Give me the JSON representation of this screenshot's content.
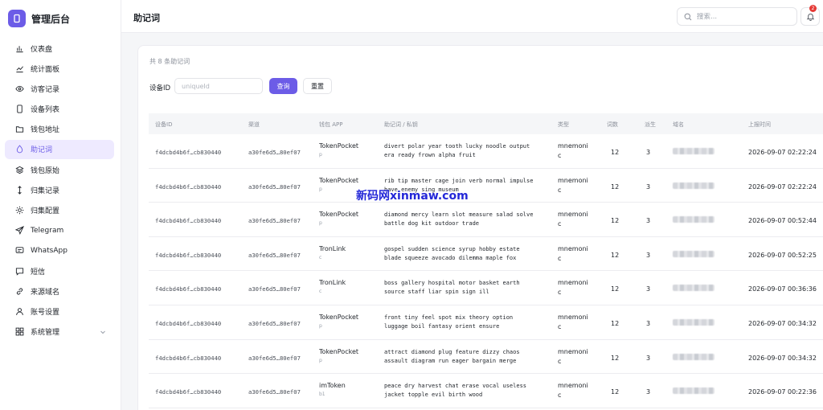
{
  "brand": {
    "title": "管理后台"
  },
  "sidebar": {
    "items": [
      {
        "label": "仪表盘",
        "icon": "bar-chart-icon"
      },
      {
        "label": "统计面板",
        "icon": "line-chart-icon"
      },
      {
        "label": "访客记录",
        "icon": "eye-icon"
      },
      {
        "label": "设备列表",
        "icon": "phone-icon"
      },
      {
        "label": "钱包地址",
        "icon": "folder-icon"
      },
      {
        "label": "助记词",
        "icon": "droplet-icon",
        "active": true
      },
      {
        "label": "钱包原始",
        "icon": "layers-icon"
      },
      {
        "label": "归集记录",
        "icon": "arrows-vertical-icon"
      },
      {
        "label": "归集配置",
        "icon": "sun-icon"
      },
      {
        "label": "Telegram",
        "icon": "send-icon"
      },
      {
        "label": "WhatsApp",
        "icon": "message-icon"
      },
      {
        "label": "短信",
        "icon": "chat-icon"
      },
      {
        "label": "来源域名",
        "icon": "link-icon"
      },
      {
        "label": "账号设置",
        "icon": "user-icon"
      },
      {
        "label": "系统管理",
        "icon": "grid-icon",
        "has_chevron": true
      }
    ]
  },
  "header": {
    "title": "助记词",
    "search_placeholder": "搜索...",
    "notification_count": "2"
  },
  "main": {
    "count_text": "共 8 条助记词",
    "filter": {
      "label": "设备ID",
      "placeholder": "uniqueId",
      "query_label": "查询",
      "reset_label": "重置"
    },
    "columns": [
      "设备ID",
      "渠道",
      "钱包 APP",
      "助记词 / 私钥",
      "类型",
      "词数",
      "派生",
      "域名",
      "上报时间"
    ],
    "rows": [
      {
        "device": "f4dcbd4b6f…cb830440",
        "channel": "a30fe6d5…80ef07",
        "app": "TokenPocket",
        "app_sub": "p",
        "mnemonic_1": "divert polar year tooth lucky noodle output",
        "mnemonic_2": "era ready frown alpha fruit",
        "type": "mnemonic",
        "words": "12",
        "derive": "3",
        "time": "2026-09-07 02:22:24"
      },
      {
        "device": "f4dcbd4b6f…cb830440",
        "channel": "a30fe6d5…80ef07",
        "app": "TokenPocket",
        "app_sub": "p",
        "mnemonic_1": "rib tip master cage join verb normal impulse",
        "mnemonic_2": "have enemy sing museum",
        "type": "mnemonic",
        "words": "12",
        "derive": "3",
        "time": "2026-09-07 02:22:24"
      },
      {
        "device": "f4dcbd4b6f…cb830440",
        "channel": "a30fe6d5…80ef07",
        "app": "TokenPocket",
        "app_sub": "p",
        "mnemonic_1": "diamond mercy learn slot measure salad solve",
        "mnemonic_2": "battle dog kit outdoor trade",
        "type": "mnemonic",
        "words": "12",
        "derive": "3",
        "time": "2026-09-07 00:52:44"
      },
      {
        "device": "f4dcbd4b6f…cb830440",
        "channel": "a30fe6d5…80ef07",
        "app": "TronLink",
        "app_sub": "c",
        "mnemonic_1": "gospel sudden science syrup hobby estate",
        "mnemonic_2": "blade squeeze avocado dilemma maple fox",
        "type": "mnemonic",
        "words": "12",
        "derive": "3",
        "time": "2026-09-07 00:52:25"
      },
      {
        "device": "f4dcbd4b6f…cb830440",
        "channel": "a30fe6d5…80ef07",
        "app": "TronLink",
        "app_sub": "c",
        "mnemonic_1": "boss gallery hospital motor basket earth",
        "mnemonic_2": "source staff liar spin sign ill",
        "type": "mnemonic",
        "words": "12",
        "derive": "3",
        "time": "2026-09-07 00:36:36"
      },
      {
        "device": "f4dcbd4b6f…cb830440",
        "channel": "a30fe6d5…80ef07",
        "app": "TokenPocket",
        "app_sub": "p",
        "mnemonic_1": "front tiny feel spot mix theory option",
        "mnemonic_2": "luggage boil fantasy orient ensure",
        "type": "mnemonic",
        "words": "12",
        "derive": "3",
        "time": "2026-09-07 00:34:32"
      },
      {
        "device": "f4dcbd4b6f…cb830440",
        "channel": "a30fe6d5…80ef07",
        "app": "TokenPocket",
        "app_sub": "p",
        "mnemonic_1": "attract diamond plug feature dizzy chaos",
        "mnemonic_2": "assault diagram run eager bargain merge",
        "type": "mnemonic",
        "words": "12",
        "derive": "3",
        "time": "2026-09-07 00:34:32"
      },
      {
        "device": "f4dcbd4b6f…cb830440",
        "channel": "a30fe6d5…80ef07",
        "app": "imToken",
        "app_sub": "b1",
        "mnemonic_1": "peace dry harvest chat erase vocal useless",
        "mnemonic_2": "jacket topple evil birth wood",
        "type": "mnemonic",
        "words": "12",
        "derive": "3",
        "time": "2026-09-07 00:22:36"
      }
    ]
  },
  "watermark": "新码网xinmaw.com",
  "colors": {
    "accent": "#6c5ce7",
    "active_bg": "#eeeaff",
    "badge": "#e53935",
    "watermark": "#2428d8"
  }
}
